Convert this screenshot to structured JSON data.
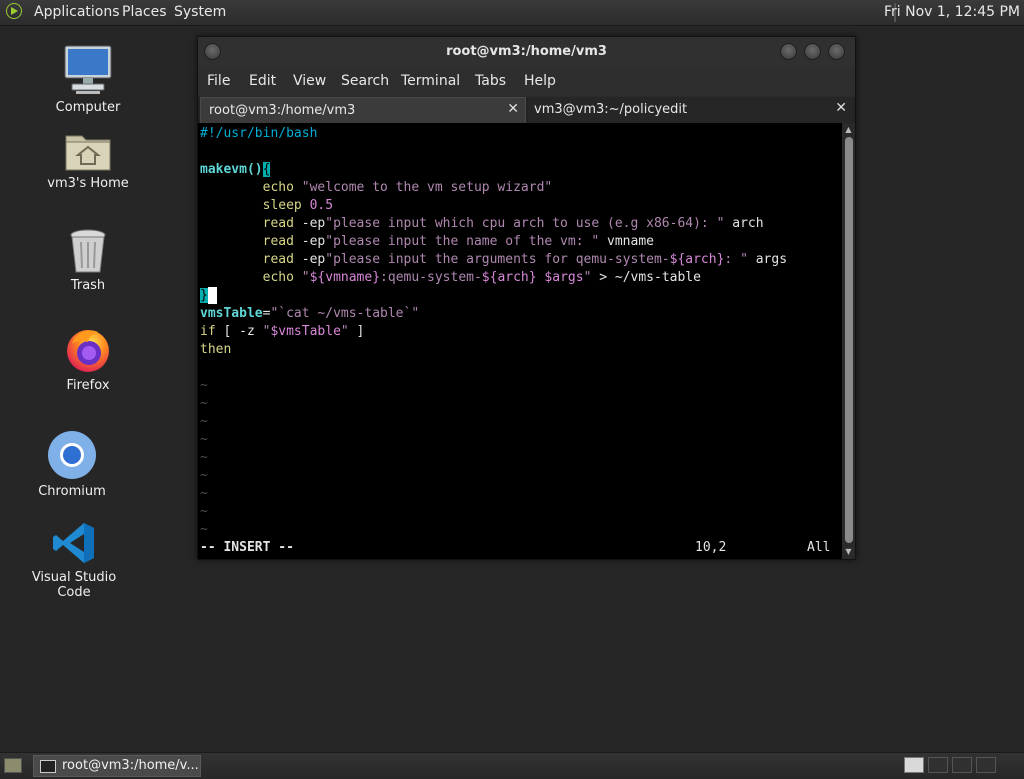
{
  "top_panel": {
    "menus": [
      "Applications",
      "Places",
      "System"
    ],
    "clock": "Fri Nov 1, 12:45 PM",
    "logo_icon": "gnome-foot-icon"
  },
  "desktop": {
    "icons": [
      {
        "label": "Computer",
        "icon": "monitor-icon"
      },
      {
        "label": "vm3's Home",
        "icon": "home-folder-icon"
      },
      {
        "label": "Trash",
        "icon": "trash-icon"
      },
      {
        "label": "Firefox",
        "icon": "firefox-icon"
      },
      {
        "label": "Chromium",
        "icon": "chromium-icon"
      },
      {
        "label": "Visual Studio Code",
        "icon": "vscode-icon"
      }
    ]
  },
  "window": {
    "title": "root@vm3:/home/vm3",
    "menu": [
      "File",
      "Edit",
      "View",
      "Search",
      "Terminal",
      "Tabs",
      "Help"
    ],
    "tabs": [
      {
        "label": "root@vm3:/home/vm3",
        "active": true
      },
      {
        "label": "vm3@vm3:~/policyedit",
        "active": false
      }
    ]
  },
  "editor": {
    "shebang": "#!/usr/bin/bash",
    "func_name": "makevm()",
    "open_brace": "{",
    "echo1_cmd": "echo ",
    "echo1_str": "\"welcome to the vm setup wizard\"",
    "sleep_cmd": "sleep ",
    "sleep_val": "0.5",
    "read_cmd": "read ",
    "read_flag": "-ep",
    "read1_str": "\"please input which cpu arch to use (e.g x86-64): \"",
    "read1_var": " arch",
    "read2_str": "\"please input the name of the vm: \"",
    "read2_var": " vmname",
    "read3_str_a": "\"please input the arguments for qemu-system-",
    "read3_var_inner": "${arch}",
    "read3_str_b": ": \"",
    "read3_var": " args",
    "echo2_cmd": "echo ",
    "echo2_q1": "\"",
    "echo2_v1": "${vmname}",
    "echo2_s1": ":qemu-system-",
    "echo2_v2": "${arch}",
    "echo2_sp": " ",
    "echo2_v3": "$args",
    "echo2_q2": "\"",
    "echo2_rest": " > ~/vms-table",
    "close_brace": "}",
    "vms_name": "vmsTable",
    "vms_eq": "=",
    "vms_str": "\"`cat ~/vms-table`\"",
    "if_kw": "if",
    "if_rest_a": " [ -z ",
    "if_q1": "\"",
    "if_var": "$vmsTable",
    "if_q2": "\"",
    "if_rest_b": " ]",
    "then_kw": "then",
    "tilde": "~",
    "status_mode": "-- INSERT --",
    "status_pos": "10,2",
    "status_scroll": "All"
  },
  "bottom_panel": {
    "task_label": "root@vm3:/home/v..."
  }
}
